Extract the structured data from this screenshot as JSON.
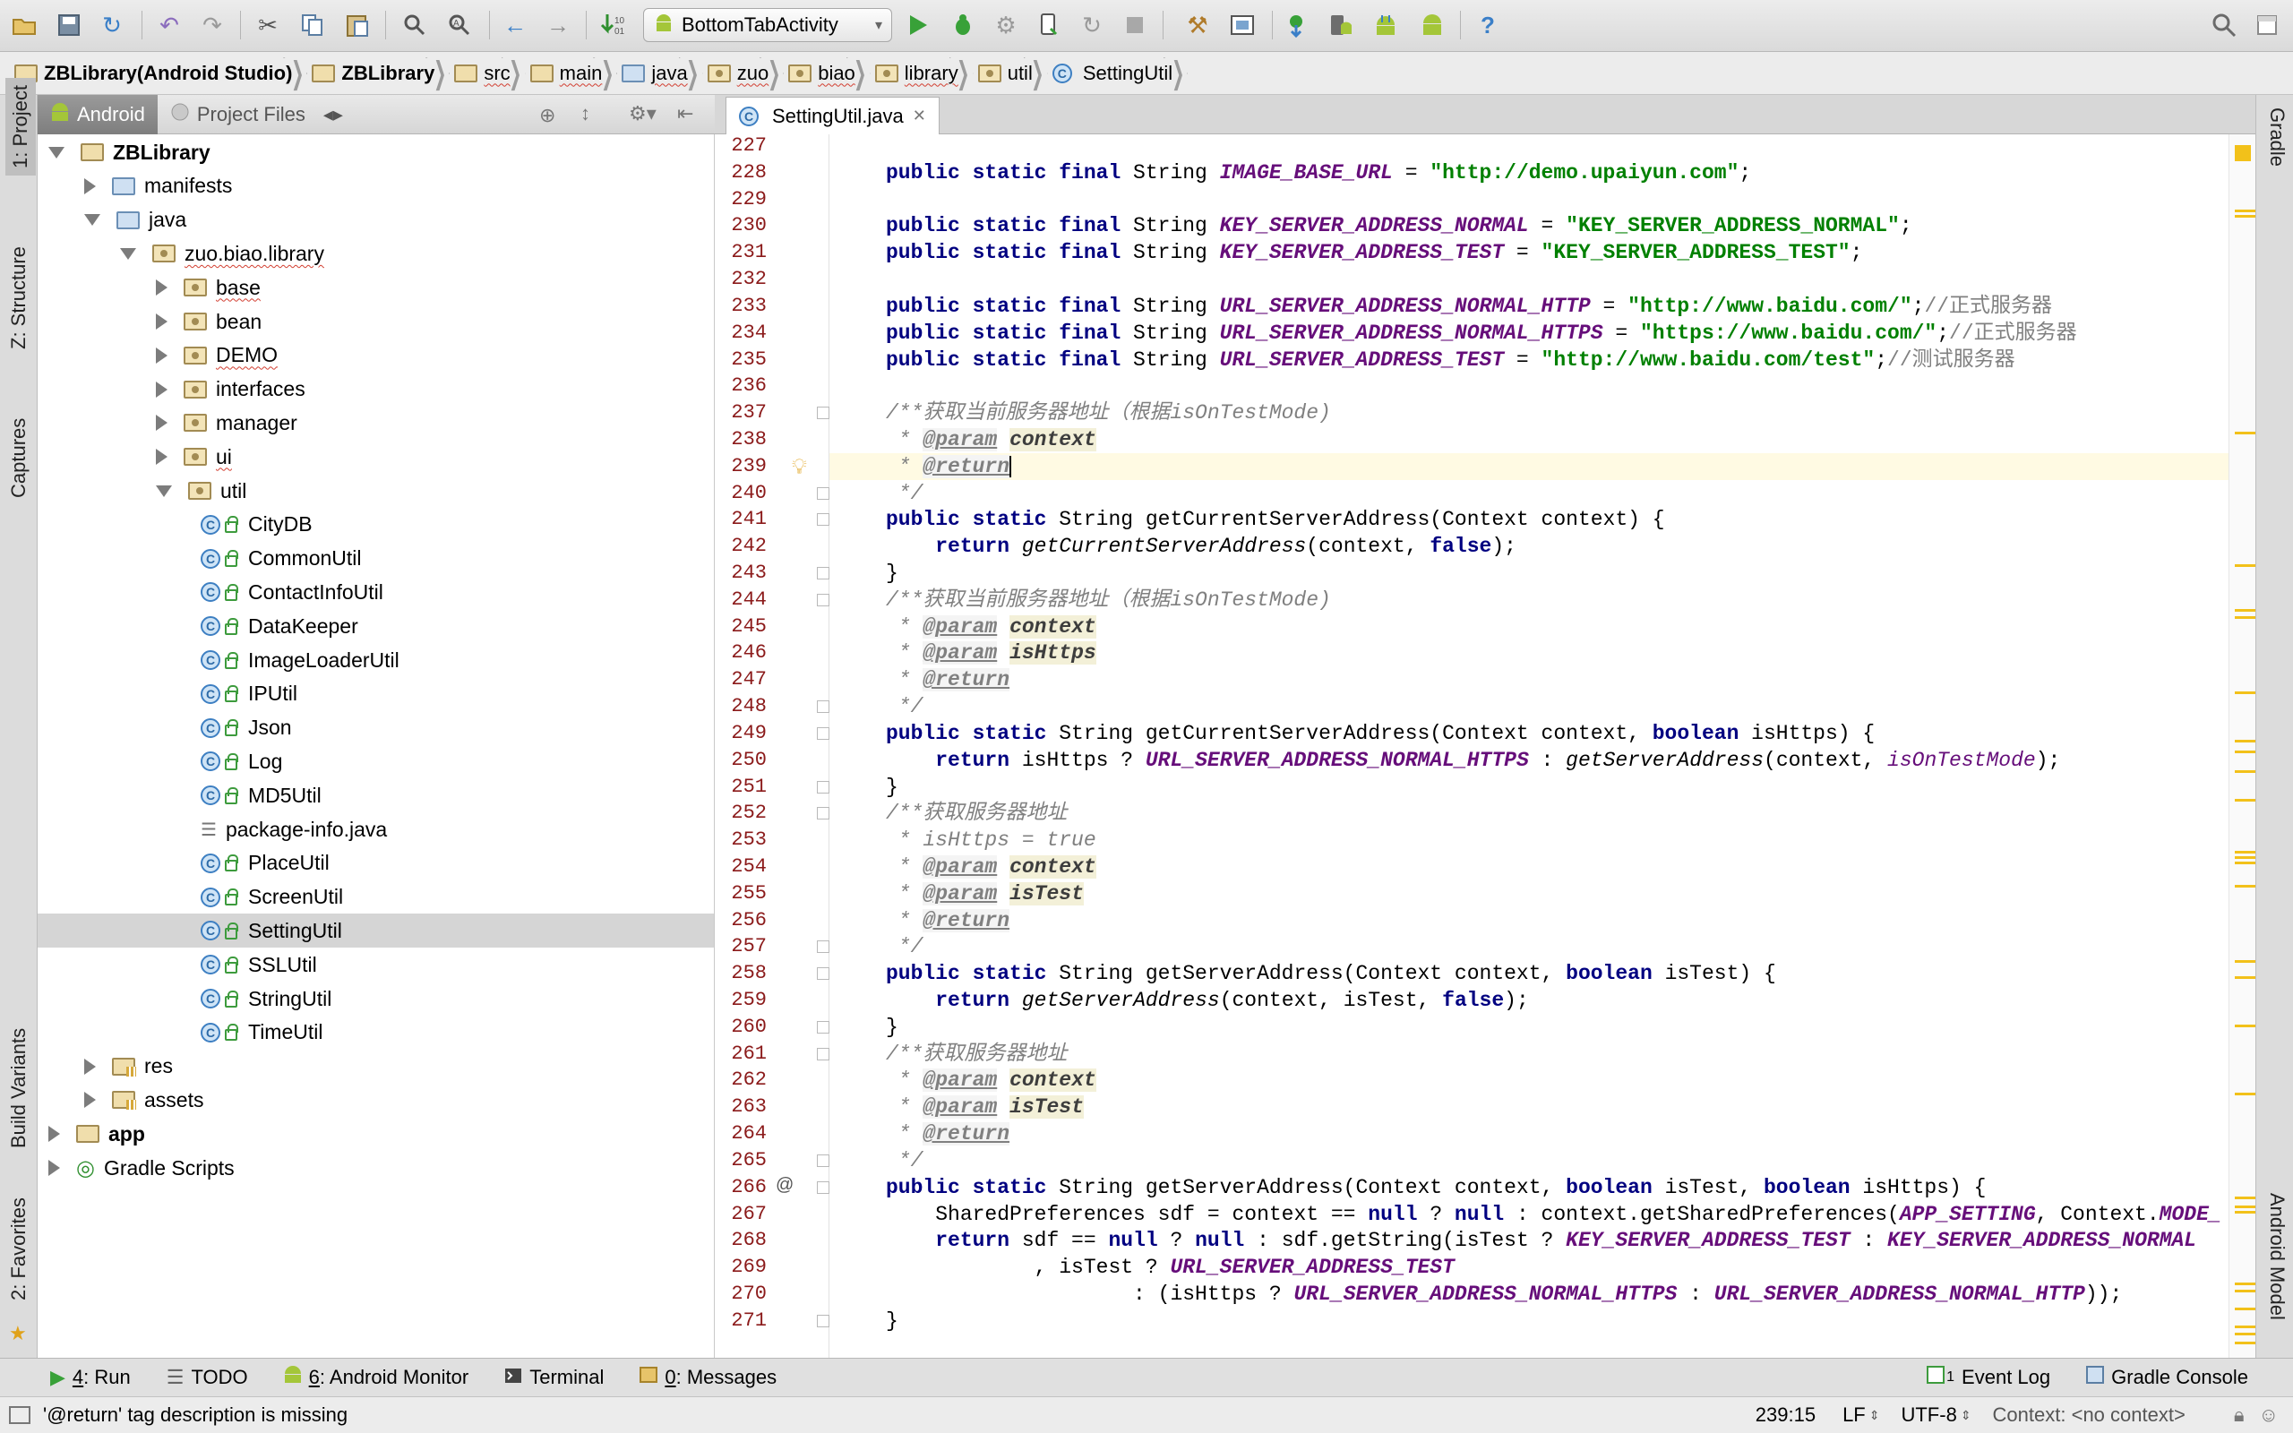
{
  "toolbar": {
    "run_config": "BottomTabActivity",
    "buttons": [
      "open-folder",
      "save",
      "sync",
      "undo",
      "redo",
      "cut",
      "copy",
      "paste",
      "find",
      "replace",
      "back",
      "forward",
      "make-project",
      "run",
      "debug",
      "attach",
      "apply-changes",
      "profile",
      "stop",
      "project-structure",
      "sdk-manager",
      "gradle-sync",
      "avd-manager",
      "android-device-monitor",
      "android",
      "help"
    ],
    "search_icon": "search-icon"
  },
  "breadcrumbs": [
    "ZBLibrary(Android Studio)",
    "ZBLibrary",
    "src",
    "main",
    "java",
    "zuo",
    "biao",
    "library",
    "util",
    "SettingUtil"
  ],
  "left_strip": {
    "project": "1: Project",
    "structure": "Z: Structure",
    "captures": "Captures",
    "build_variants": "Build Variants",
    "favorites": "2: Favorites"
  },
  "right_strip": {
    "gradle": "Gradle",
    "android_model": "Android Model"
  },
  "project_panel": {
    "tabs": [
      "Android",
      "Project Files"
    ],
    "tree": [
      {
        "label": "ZBLibrary",
        "bold": true,
        "depth": 0,
        "state": "open",
        "icon": "module"
      },
      {
        "label": "manifests",
        "depth": 1,
        "state": "closed",
        "icon": "folder-blue"
      },
      {
        "label": "java",
        "depth": 1,
        "state": "open",
        "icon": "folder-blue"
      },
      {
        "label": "zuo.biao.library",
        "depth": 2,
        "state": "open",
        "icon": "package"
      },
      {
        "label": "base",
        "depth": 3,
        "state": "closed",
        "icon": "package"
      },
      {
        "label": "bean",
        "depth": 3,
        "state": "closed",
        "icon": "package"
      },
      {
        "label": "DEMO",
        "depth": 3,
        "state": "closed",
        "icon": "package"
      },
      {
        "label": "interfaces",
        "depth": 3,
        "state": "closed",
        "icon": "package"
      },
      {
        "label": "manager",
        "depth": 3,
        "state": "closed",
        "icon": "package"
      },
      {
        "label": "ui",
        "depth": 3,
        "state": "closed",
        "icon": "package"
      },
      {
        "label": "util",
        "depth": 3,
        "state": "open",
        "icon": "package"
      },
      {
        "label": "CityDB",
        "depth": 4,
        "icon": "class"
      },
      {
        "label": "CommonUtil",
        "depth": 4,
        "icon": "class"
      },
      {
        "label": "ContactInfoUtil",
        "depth": 4,
        "icon": "class"
      },
      {
        "label": "DataKeeper",
        "depth": 4,
        "icon": "class"
      },
      {
        "label": "ImageLoaderUtil",
        "depth": 4,
        "icon": "class"
      },
      {
        "label": "IPUtil",
        "depth": 4,
        "icon": "class"
      },
      {
        "label": "Json",
        "depth": 4,
        "icon": "class"
      },
      {
        "label": "Log",
        "depth": 4,
        "icon": "class"
      },
      {
        "label": "MD5Util",
        "depth": 4,
        "icon": "class"
      },
      {
        "label": "package-info.java",
        "depth": 4,
        "icon": "file"
      },
      {
        "label": "PlaceUtil",
        "depth": 4,
        "icon": "class"
      },
      {
        "label": "ScreenUtil",
        "depth": 4,
        "icon": "class"
      },
      {
        "label": "SettingUtil",
        "depth": 4,
        "icon": "class",
        "selected": true
      },
      {
        "label": "SSLUtil",
        "depth": 4,
        "icon": "class"
      },
      {
        "label": "StringUtil",
        "depth": 4,
        "icon": "class"
      },
      {
        "label": "TimeUtil",
        "depth": 4,
        "icon": "class"
      },
      {
        "label": "res",
        "depth": 1,
        "state": "closed",
        "icon": "folder-res"
      },
      {
        "label": "assets",
        "depth": 1,
        "state": "closed",
        "icon": "folder-res"
      },
      {
        "label": "app",
        "bold": true,
        "depth": 0,
        "state": "closed",
        "icon": "module"
      },
      {
        "label": "Gradle Scripts",
        "depth": 0,
        "state": "closed",
        "icon": "gradle"
      }
    ]
  },
  "editor": {
    "tab": "SettingUtil.java",
    "current_line": 239,
    "lines": [
      {
        "n": "227",
        "html": ""
      },
      {
        "n": "228",
        "html": "<span class='kw'>public static final </span>String <span class='cst'>IMAGE_BASE_URL</span> = <span class='str'>\"http://demo.upaiyun.com\"</span>;"
      },
      {
        "n": "229",
        "html": ""
      },
      {
        "n": "230",
        "html": "<span class='kw'>public static final </span>String <span class='cst'>KEY_SERVER_ADDRESS_NORMAL</span> = <span class='str'>\"KEY_SERVER_ADDRESS_NORMAL\"</span>;"
      },
      {
        "n": "231",
        "html": "<span class='kw'>public static final </span>String <span class='cst'>KEY_SERVER_ADDRESS_TEST</span> = <span class='str'>\"KEY_SERVER_ADDRESS_TEST\"</span>;"
      },
      {
        "n": "232",
        "html": ""
      },
      {
        "n": "233",
        "html": "<span class='kw'>public static final </span>String <span class='cst'>URL_SERVER_ADDRESS_NORMAL_HTTP</span> = <span class='str'>\"http://www.baidu.com/\"</span>;<span class='cmp'>//正式服务器</span>"
      },
      {
        "n": "234",
        "html": "<span class='kw'>public static final </span>String <span class='cst'>URL_SERVER_ADDRESS_NORMAL_HTTPS</span> = <span class='str'>\"https://www.baidu.com/\"</span>;<span class='cmp'>//正式服务器</span>"
      },
      {
        "n": "235",
        "html": "<span class='kw'>public static final </span>String <span class='cst'>URL_SERVER_ADDRESS_TEST</span> = <span class='str'>\"http://www.baidu.com/test\"</span>;<span class='cmp'>//测试服务器</span>"
      },
      {
        "n": "236",
        "html": ""
      },
      {
        "n": "237",
        "html": "<span class='cm'>/**获取当前服务器地址（根据isOnTestMode)</span>"
      },
      {
        "n": "238",
        "html": "<span class='cm'> * </span><span class='tag'>@param</span> <span class='pn'>context</span>"
      },
      {
        "n": "239",
        "html": "<span class='cm'> * </span><span class='tag'>@return</span>"
      },
      {
        "n": "240",
        "html": "<span class='cm'> */</span>"
      },
      {
        "n": "241",
        "html": "<span class='kw'>public static </span>String getCurrentServerAddress(Context context) {"
      },
      {
        "n": "242",
        "html": "    <span class='kw'>return </span><span class='it'>getCurrentServerAddress</span>(context, <span class='kw'>false</span>);"
      },
      {
        "n": "243",
        "html": "}"
      },
      {
        "n": "244",
        "html": "<span class='cm'>/**获取当前服务器地址（根据isOnTestMode)</span>"
      },
      {
        "n": "245",
        "html": "<span class='cm'> * </span><span class='tag'>@param</span> <span class='pn'>context</span>"
      },
      {
        "n": "246",
        "html": "<span class='cm'> * </span><span class='tag'>@param</span> <span class='pn'>isHttps</span>"
      },
      {
        "n": "247",
        "html": "<span class='cm'> * </span><span class='tag'>@return</span>"
      },
      {
        "n": "248",
        "html": "<span class='cm'> */</span>"
      },
      {
        "n": "249",
        "html": "<span class='kw'>public static </span>String getCurrentServerAddress(Context context, <span class='kw'>boolean </span>isHttps) {"
      },
      {
        "n": "250",
        "html": "    <span class='kw'>return </span>isHttps ? <span class='cst'>URL_SERVER_ADDRESS_NORMAL_HTTPS</span> : <span class='it'>getServerAddress</span>(context, <span class='fld'>isOnTestMode</span>);"
      },
      {
        "n": "251",
        "html": "}"
      },
      {
        "n": "252",
        "html": "<span class='cm'>/**获取服务器地址</span>"
      },
      {
        "n": "253",
        "html": "<span class='cm'> * isHttps = true</span>"
      },
      {
        "n": "254",
        "html": "<span class='cm'> * </span><span class='tag'>@param</span> <span class='pn'>context</span>"
      },
      {
        "n": "255",
        "html": "<span class='cm'> * </span><span class='tag'>@param</span> <span class='pn'>isTest</span>"
      },
      {
        "n": "256",
        "html": "<span class='cm'> * </span><span class='tag'>@return</span>"
      },
      {
        "n": "257",
        "html": "<span class='cm'> */</span>"
      },
      {
        "n": "258",
        "html": "<span class='kw'>public static </span>String getServerAddress(Context context, <span class='kw'>boolean </span>isTest) {"
      },
      {
        "n": "259",
        "html": "    <span class='kw'>return </span><span class='it'>getServerAddress</span>(context, isTest, <span class='kw'>false</span>);"
      },
      {
        "n": "260",
        "html": "}"
      },
      {
        "n": "261",
        "html": "<span class='cm'>/**获取服务器地址</span>"
      },
      {
        "n": "262",
        "html": "<span class='cm'> * </span><span class='tag'>@param</span> <span class='pn'>context</span>"
      },
      {
        "n": "263",
        "html": "<span class='cm'> * </span><span class='tag'>@param</span> <span class='pn'>isTest</span>"
      },
      {
        "n": "264",
        "html": "<span class='cm'> * </span><span class='tag'>@return</span>"
      },
      {
        "n": "265",
        "html": "<span class='cm'> */</span>"
      },
      {
        "n": "266",
        "html": "<span class='kw'>public static </span>String getServerAddress(Context context, <span class='kw'>boolean </span>isTest, <span class='kw'>boolean </span>isHttps) {"
      },
      {
        "n": "267",
        "html": "    SharedPreferences sdf = context == <span class='kw'>null </span>? <span class='kw'>null </span>: context.getSharedPreferences(<span class='cst'>APP_SETTING</span>, Context.<span class='cst'>MODE_</span>"
      },
      {
        "n": "268",
        "html": "    <span class='kw'>return </span>sdf == <span class='kw'>null </span>? <span class='kw'>null </span>: sdf.getString(isTest ? <span class='cst'>KEY_SERVER_ADDRESS_TEST</span> : <span class='cst'>KEY_SERVER_ADDRESS_NORMAL</span>"
      },
      {
        "n": "269",
        "html": "            , isTest ? <span class='cst'>URL_SERVER_ADDRESS_TEST</span>"
      },
      {
        "n": "270",
        "html": "                    : (isHttps ? <span class='cst'>URL_SERVER_ADDRESS_NORMAL_HTTPS</span> : <span class='cst'>URL_SERVER_ADDRESS_NORMAL_HTTP</span>));"
      },
      {
        "n": "271",
        "html": "}"
      }
    ]
  },
  "bottom_tools": [
    {
      "key": "4",
      "label": ": Run",
      "icon": "run-icon"
    },
    {
      "key": "",
      "label": "TODO",
      "icon": "todo-icon"
    },
    {
      "key": "6",
      "label": ": Android Monitor",
      "icon": "android-icon"
    },
    {
      "key": "",
      "label": "Terminal",
      "icon": "terminal-icon"
    },
    {
      "key": "0",
      "label": ": Messages",
      "icon": "messages-icon"
    }
  ],
  "bottom_right": {
    "event_log": "Event Log",
    "event_count": "1",
    "gradle_console": "Gradle Console"
  },
  "status": {
    "message": "'@return' tag description is missing",
    "position": "239:15",
    "line_sep": "LF",
    "encoding": "UTF-8",
    "context": "Context: <no context>"
  },
  "colors": {
    "accent": "#2f8f2f",
    "line_number": "#8b1a1a",
    "keyword": "#000080",
    "constant": "#660e7a",
    "string": "#008000",
    "comment": "#808080",
    "marker": "#f2c11a"
  }
}
